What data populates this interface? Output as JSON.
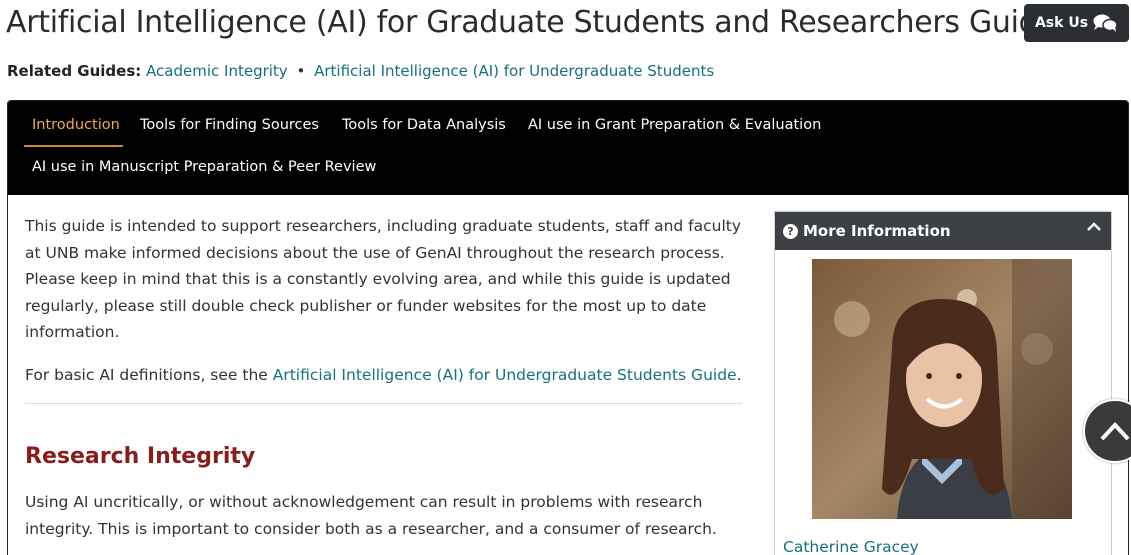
{
  "header": {
    "title": "Artificial Intelligence (AI) for Graduate Students and Researchers Guide",
    "ask_us_label": "Ask Us"
  },
  "related": {
    "label": "Related Guides:",
    "links": [
      "Academic Integrity",
      "Artificial Intelligence (AI) for Undergraduate Students"
    ],
    "separator": "•"
  },
  "tabs": [
    {
      "label": "Introduction",
      "active": true
    },
    {
      "label": "Tools for Finding Sources",
      "active": false
    },
    {
      "label": "Tools for Data Analysis",
      "active": false
    },
    {
      "label": "AI use in Grant Preparation & Evaluation",
      "active": false
    },
    {
      "label": "AI use in Manuscript Preparation & Peer Review",
      "active": false
    }
  ],
  "main": {
    "intro": "This guide is intended to support researchers, including graduate students, staff and faculty at UNB make informed decisions about the use of GenAI throughout the research process. Please keep in mind that this is a constantly evolving area, and while this guide is updated regularly, please still double check publisher or funder websites for the most up to date information.",
    "definitions_prefix": "For basic AI definitions, see the ",
    "definitions_link": "Artificial Intelligence (AI) for Undergraduate Students Guide",
    "definitions_suffix": ".",
    "section_heading": "Research Integrity",
    "section_text": "Using AI uncritically, or without acknowledgement can result in problems with research integrity. This is important to consider both as a researcher, and a consumer of research."
  },
  "side_box": {
    "title": "More Information",
    "person_name": "Catherine Gracey"
  },
  "colors": {
    "link": "#17707f",
    "active_tab": "#f0a94a",
    "heading": "#8a1c1c",
    "tab_bar": "#000000",
    "side_header": "#3d4146"
  }
}
